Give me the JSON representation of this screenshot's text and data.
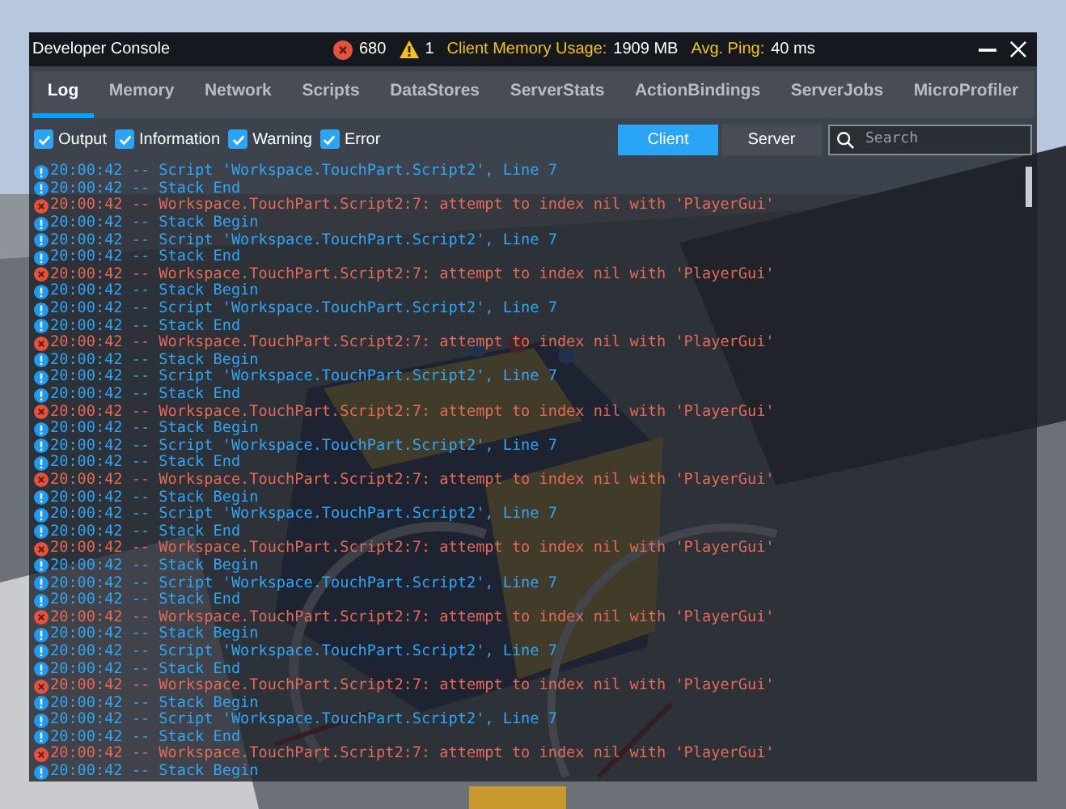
{
  "window": {
    "title": "Developer Console"
  },
  "stats": {
    "errors": "680",
    "warnings": "1",
    "memory_label": "Client Memory Usage:",
    "memory_value": "1909 MB",
    "ping_label": "Avg. Ping:",
    "ping_value": "40 ms"
  },
  "tabs": [
    {
      "label": "Log",
      "selected": true
    },
    {
      "label": "Memory",
      "selected": false
    },
    {
      "label": "Network",
      "selected": false
    },
    {
      "label": "Scripts",
      "selected": false
    },
    {
      "label": "DataStores",
      "selected": false
    },
    {
      "label": "ServerStats",
      "selected": false
    },
    {
      "label": "ActionBindings",
      "selected": false
    },
    {
      "label": "ServerJobs",
      "selected": false
    },
    {
      "label": "MicroProfiler",
      "selected": false
    }
  ],
  "filters": [
    {
      "label": "Output",
      "checked": true
    },
    {
      "label": "Information",
      "checked": true
    },
    {
      "label": "Warning",
      "checked": true
    },
    {
      "label": "Error",
      "checked": true
    }
  ],
  "sources": [
    {
      "label": "Client",
      "selected": true
    },
    {
      "label": "Server",
      "selected": false
    }
  ],
  "search": {
    "placeholder": "Search"
  },
  "log": [
    {
      "kind": "info",
      "text": "20:00:42 -- Script 'Workspace.TouchPart.Script2', Line 7"
    },
    {
      "kind": "info",
      "text": "20:00:42 -- Stack End"
    },
    {
      "kind": "error",
      "text": "20:00:42 -- Workspace.TouchPart.Script2:7: attempt to index nil with 'PlayerGui'"
    },
    {
      "kind": "info",
      "text": "20:00:42 -- Stack Begin"
    },
    {
      "kind": "info",
      "text": "20:00:42 -- Script 'Workspace.TouchPart.Script2', Line 7"
    },
    {
      "kind": "info",
      "text": "20:00:42 -- Stack End"
    },
    {
      "kind": "error",
      "text": "20:00:42 -- Workspace.TouchPart.Script2:7: attempt to index nil with 'PlayerGui'"
    },
    {
      "kind": "info",
      "text": "20:00:42 -- Stack Begin"
    },
    {
      "kind": "info",
      "text": "20:00:42 -- Script 'Workspace.TouchPart.Script2', Line 7"
    },
    {
      "kind": "info",
      "text": "20:00:42 -- Stack End"
    },
    {
      "kind": "error",
      "text": "20:00:42 -- Workspace.TouchPart.Script2:7: attempt to index nil with 'PlayerGui'"
    },
    {
      "kind": "info",
      "text": "20:00:42 -- Stack Begin"
    },
    {
      "kind": "info",
      "text": "20:00:42 -- Script 'Workspace.TouchPart.Script2', Line 7"
    },
    {
      "kind": "info",
      "text": "20:00:42 -- Stack End"
    },
    {
      "kind": "error",
      "text": "20:00:42 -- Workspace.TouchPart.Script2:7: attempt to index nil with 'PlayerGui'"
    },
    {
      "kind": "info",
      "text": "20:00:42 -- Stack Begin"
    },
    {
      "kind": "info",
      "text": "20:00:42 -- Script 'Workspace.TouchPart.Script2', Line 7"
    },
    {
      "kind": "info",
      "text": "20:00:42 -- Stack End"
    },
    {
      "kind": "error",
      "text": "20:00:42 -- Workspace.TouchPart.Script2:7: attempt to index nil with 'PlayerGui'"
    },
    {
      "kind": "info",
      "text": "20:00:42 -- Stack Begin"
    },
    {
      "kind": "info",
      "text": "20:00:42 -- Script 'Workspace.TouchPart.Script2', Line 7"
    },
    {
      "kind": "info",
      "text": "20:00:42 -- Stack End"
    },
    {
      "kind": "error",
      "text": "20:00:42 -- Workspace.TouchPart.Script2:7: attempt to index nil with 'PlayerGui'"
    },
    {
      "kind": "info",
      "text": "20:00:42 -- Stack Begin"
    },
    {
      "kind": "info",
      "text": "20:00:42 -- Script 'Workspace.TouchPart.Script2', Line 7"
    },
    {
      "kind": "info",
      "text": "20:00:42 -- Stack End"
    },
    {
      "kind": "error",
      "text": "20:00:42 -- Workspace.TouchPart.Script2:7: attempt to index nil with 'PlayerGui'"
    },
    {
      "kind": "info",
      "text": "20:00:42 -- Stack Begin"
    },
    {
      "kind": "info",
      "text": "20:00:42 -- Script 'Workspace.TouchPart.Script2', Line 7"
    },
    {
      "kind": "info",
      "text": "20:00:42 -- Stack End"
    },
    {
      "kind": "error",
      "text": "20:00:42 -- Workspace.TouchPart.Script2:7: attempt to index nil with 'PlayerGui'"
    },
    {
      "kind": "info",
      "text": "20:00:42 -- Stack Begin"
    },
    {
      "kind": "info",
      "text": "20:00:42 -- Script 'Workspace.TouchPart.Script2', Line 7"
    },
    {
      "kind": "info",
      "text": "20:00:42 -- Stack End"
    },
    {
      "kind": "error",
      "text": "20:00:42 -- Workspace.TouchPart.Script2:7: attempt to index nil with 'PlayerGui'"
    },
    {
      "kind": "info",
      "text": "20:00:42 -- Stack Begin"
    }
  ]
}
